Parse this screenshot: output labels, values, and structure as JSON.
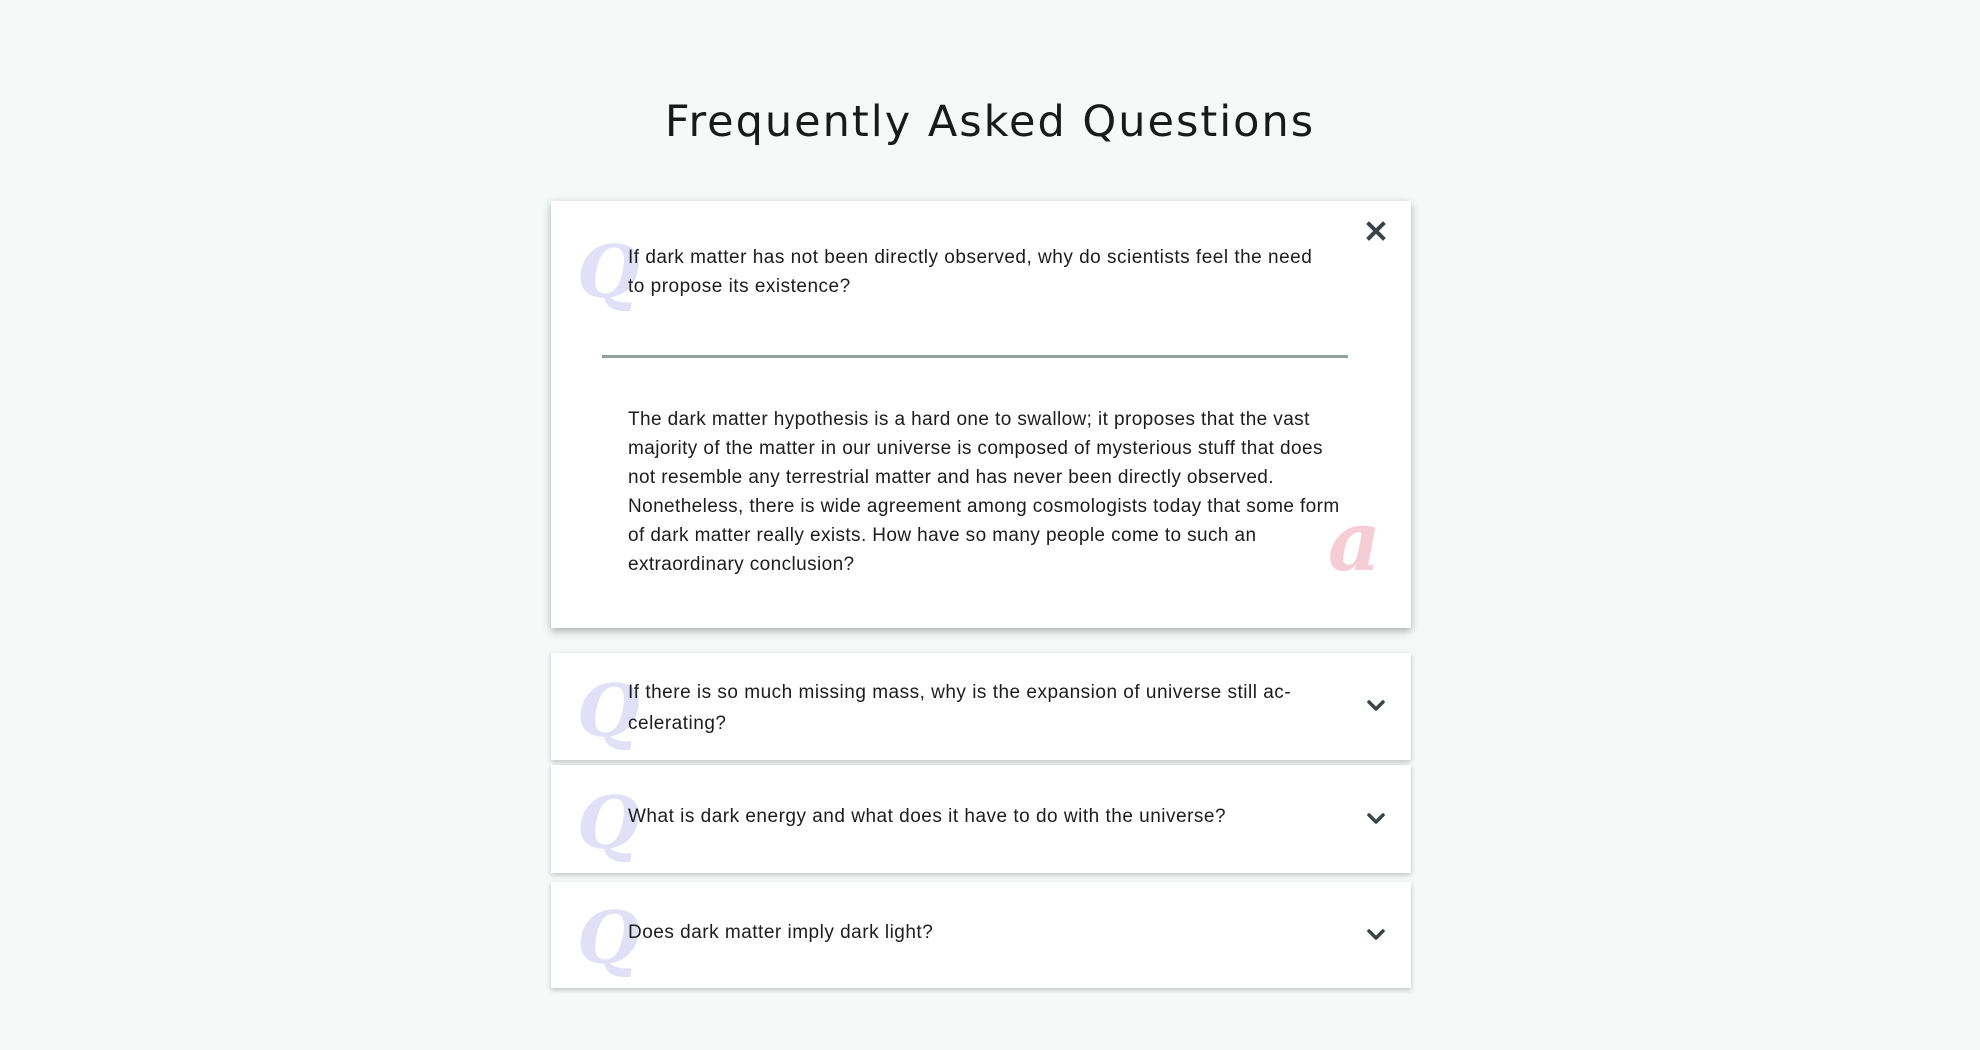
{
  "page": {
    "title": "Frequently Asked Questions"
  },
  "colors": {
    "background": "#f6f9f8",
    "card": "#ffffff",
    "q_watermark": "#e2e0f7",
    "a_watermark": "#f5cdd6",
    "divider": "#93a19f",
    "icon": "#3a4448"
  },
  "faq": {
    "q_glyph": "Q",
    "a_glyph": "a",
    "items": [
      {
        "question": "If dark matter has not been directly observed, why do scientists feel the need to propose its existence?",
        "answer": "The dark matter hypothesis is a hard one to swallow; it proposes that the vast majority of the matter in our universe is composed of mysterious stuff that does not resemble any terrestrial matter and has never been directly observed. Nonetheless, there is wide agreement among cosmologists today that some form of dark matter really exists. How have so many people come to such an extraordinary conclusion?",
        "expanded": true,
        "toggle_icon": "close-icon"
      },
      {
        "question": "If there is so much missing mass, why is the expansion of universe still ac­celerating?",
        "expanded": false,
        "toggle_icon": "chevron-down-icon"
      },
      {
        "question": "What is dark energy and what does it have to do with the universe?",
        "expanded": false,
        "toggle_icon": "chevron-down-icon"
      },
      {
        "question": "Does dark matter imply dark light?",
        "expanded": false,
        "toggle_icon": "chevron-down-icon"
      }
    ]
  }
}
